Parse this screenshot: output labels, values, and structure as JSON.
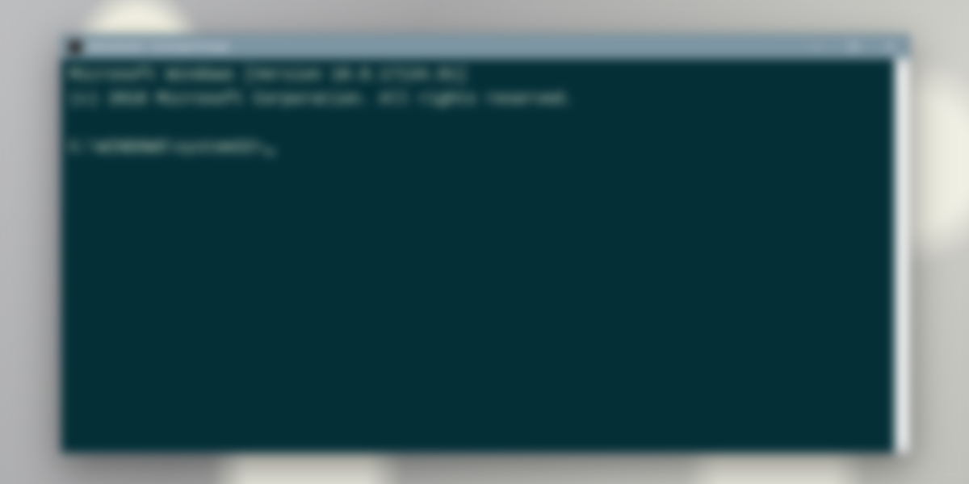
{
  "window": {
    "title": "Administrator: Command Prompt",
    "titlebar_bg": "#7d96a3",
    "titlebar_fg": "#ffffff",
    "client_bg": "#042f37",
    "text_fg": "#eef2d6"
  },
  "console": {
    "line1": "Microsoft Windows [Version 10.0.17134.81]",
    "line2": "(c) 2018 Microsoft Corporation. All rights reserved.",
    "prompt": "C:\\WINDOWS\\system32>"
  }
}
